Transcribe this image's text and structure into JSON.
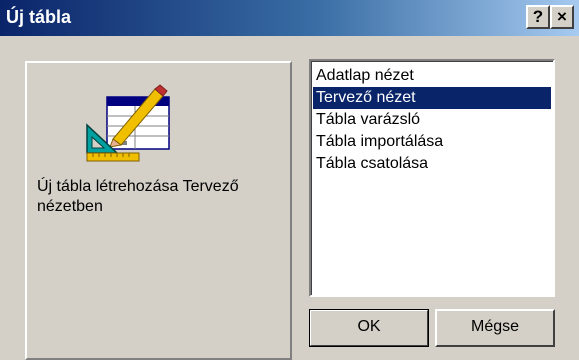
{
  "window": {
    "title": "Új tábla",
    "help_label": "?",
    "close_label": "×"
  },
  "preview": {
    "icon": "table-design-icon",
    "description": "Új tábla létrehozása Tervező nézetben"
  },
  "views": {
    "items": [
      {
        "label": "Adatlap nézet",
        "selected": false
      },
      {
        "label": "Tervező nézet",
        "selected": true
      },
      {
        "label": "Tábla varázsló",
        "selected": false
      },
      {
        "label": "Tábla importálása",
        "selected": false
      },
      {
        "label": "Tábla csatolása",
        "selected": false
      }
    ]
  },
  "buttons": {
    "ok": "OK",
    "cancel": "Mégse"
  },
  "colors": {
    "titlebar_start": "#0a246a",
    "titlebar_end": "#a6caf0",
    "selection": "#0a246a",
    "face": "#d4d0c8"
  }
}
